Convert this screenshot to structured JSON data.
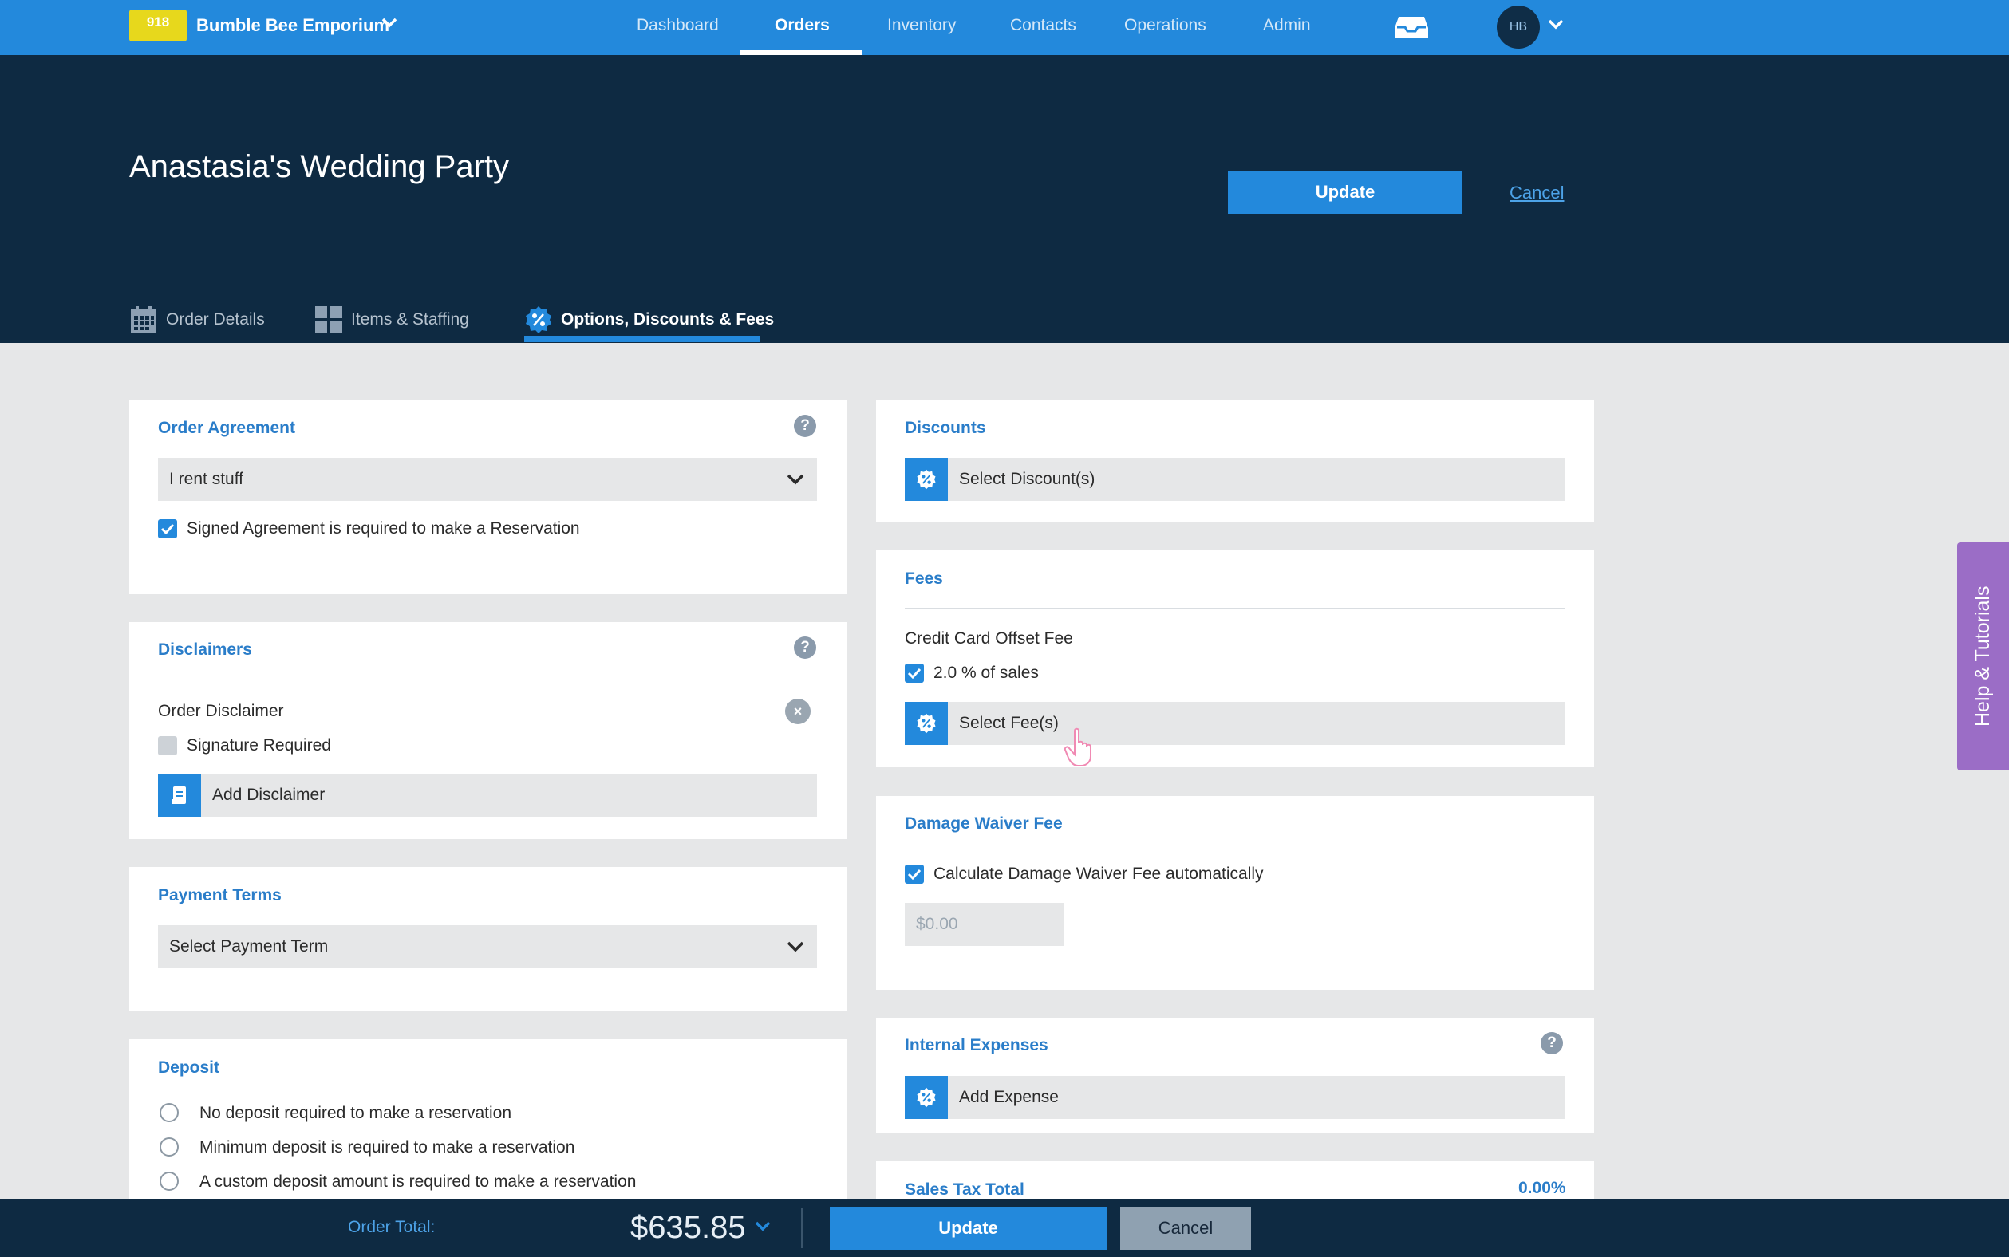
{
  "topnav": {
    "store_badge": "918",
    "store_name": "Bumble Bee Emporium",
    "items": [
      {
        "label": "Dashboard"
      },
      {
        "label": "Orders"
      },
      {
        "label": "Inventory"
      },
      {
        "label": "Contacts"
      },
      {
        "label": "Operations"
      },
      {
        "label": "Admin"
      }
    ],
    "active_item": "Orders",
    "avatar_initials": "HB"
  },
  "header": {
    "title": "Anastasia's Wedding Party",
    "update_label": "Update",
    "cancel_label": "Cancel",
    "tabs": [
      {
        "label": "Order Details",
        "icon": "calendar-icon"
      },
      {
        "label": "Items & Staffing",
        "icon": "grid-icon"
      },
      {
        "label": "Options, Discounts & Fees",
        "icon": "discount-badge-icon"
      }
    ],
    "active_tab": "Options, Discounts & Fees"
  },
  "order_agreement": {
    "title": "Order Agreement",
    "help": "?",
    "selected": "I rent stuff",
    "signed_required_label": "Signed Agreement is required to make a Reservation",
    "signed_required_checked": true
  },
  "disclaimers": {
    "title": "Disclaimers",
    "help": "?",
    "item_name": "Order Disclaimer",
    "remove": "×",
    "signature_label": "Signature Required",
    "signature_checked": false,
    "add_label": "Add Disclaimer"
  },
  "payment_terms": {
    "title": "Payment Terms",
    "placeholder": "Select Payment Term"
  },
  "deposit": {
    "title": "Deposit",
    "options": [
      {
        "label": "No deposit required to make a reservation"
      },
      {
        "label": "Minimum deposit is required to make a reservation"
      },
      {
        "label": "A custom deposit amount is required to make a reservation"
      }
    ]
  },
  "discounts": {
    "title": "Discounts",
    "select_label": "Select Discount(s)"
  },
  "fees": {
    "title": "Fees",
    "fee_name": "Credit Card Offset Fee",
    "fee_option_label": "2.0 % of sales",
    "fee_option_checked": true,
    "select_label": "Select Fee(s)"
  },
  "damage_waiver": {
    "title": "Damage Waiver Fee",
    "auto_label": "Calculate Damage Waiver Fee automatically",
    "auto_checked": true,
    "amount_placeholder": "$0.00"
  },
  "internal_expenses": {
    "title": "Internal Expenses",
    "help": "?",
    "add_label": "Add Expense"
  },
  "sales_tax": {
    "title": "Sales Tax Total",
    "value": "0.00%"
  },
  "help_tab": {
    "label": "Help & Tutorials"
  },
  "bottombar": {
    "total_label": "Order Total:",
    "total_value": "$635.85",
    "update_label": "Update",
    "cancel_label": "Cancel"
  },
  "colors": {
    "primary": "#2389dc",
    "header_bg": "#0e2a42",
    "badge": "#e7d81c",
    "help_tab": "#9b6dc6",
    "page_bg": "#e6e7e8"
  }
}
